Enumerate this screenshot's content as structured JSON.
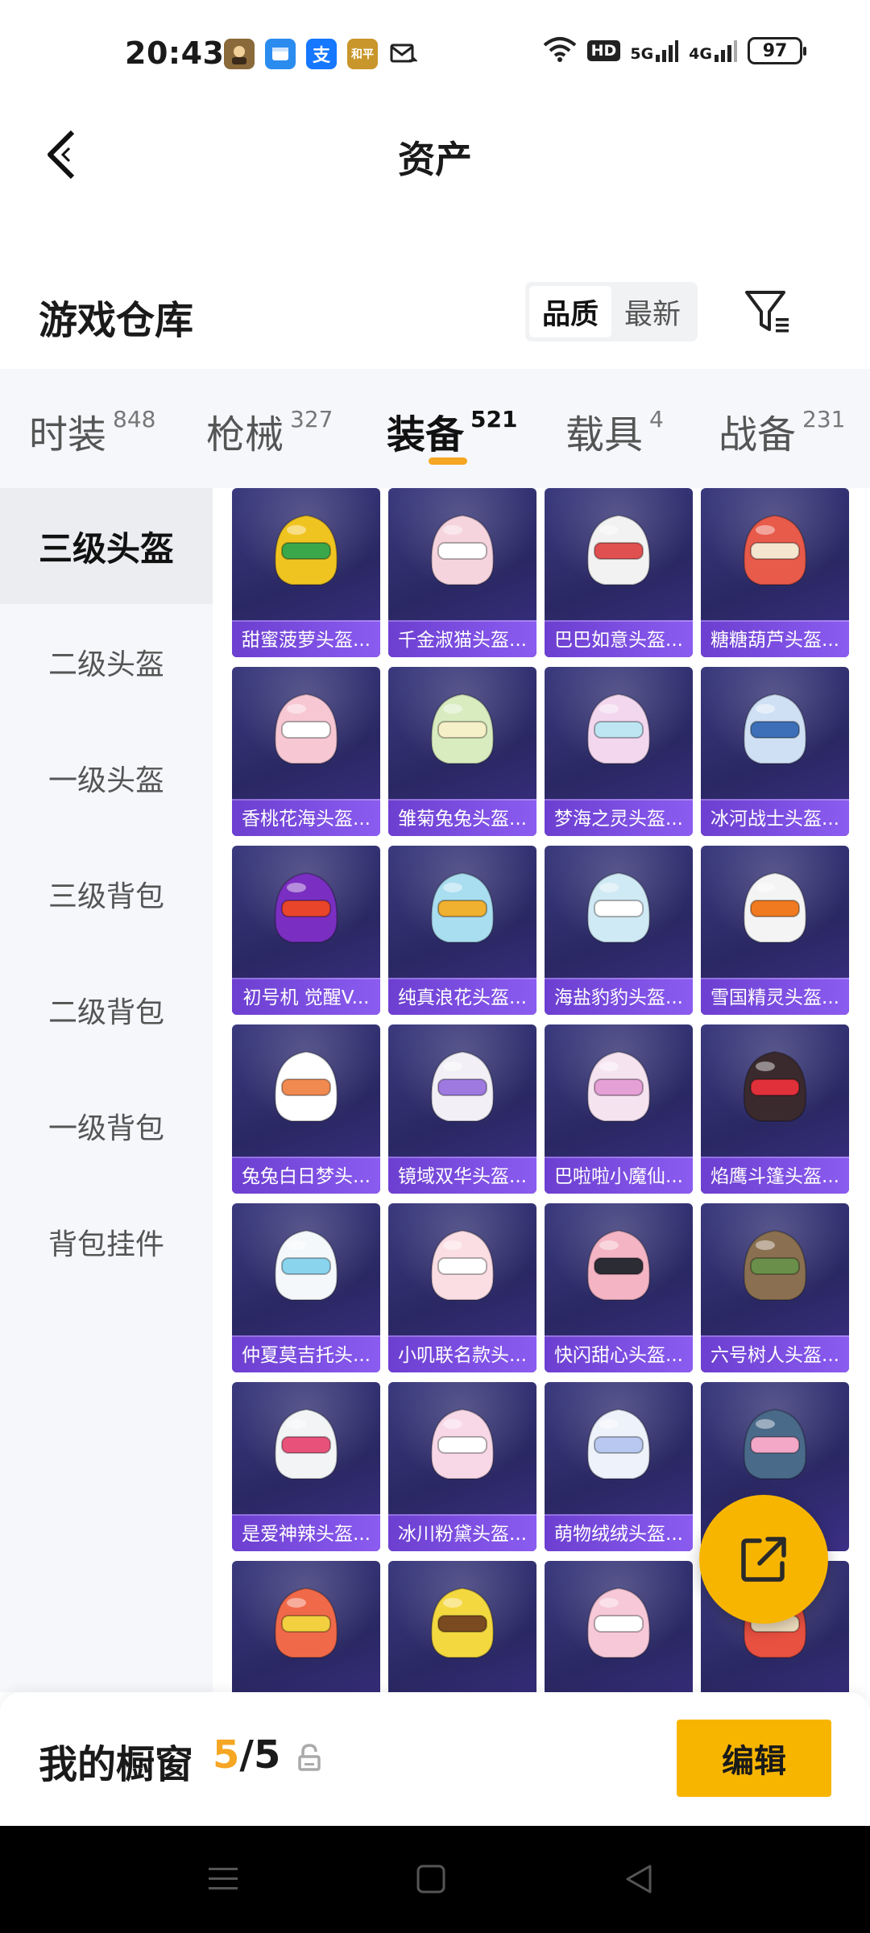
{
  "status_bar": {
    "time": "20:43",
    "battery": "97",
    "network_1": "5G",
    "network_2": "4G",
    "hd_badge": "HD",
    "notif_alipay": "支",
    "notif_pubg": "和平"
  },
  "header": {
    "title": "资产"
  },
  "warehouse": {
    "title": "游戏仓库",
    "sort_options": [
      "品质",
      "最新"
    ],
    "active_sort": "品质"
  },
  "tabs": [
    {
      "label": "时装",
      "count": "848"
    },
    {
      "label": "枪械",
      "count": "327"
    },
    {
      "label": "装备",
      "count": "521"
    },
    {
      "label": "载具",
      "count": "4"
    },
    {
      "label": "战备",
      "count": "231"
    }
  ],
  "active_tab": "装备",
  "sidebar": {
    "items": [
      {
        "label": "三级头盔"
      },
      {
        "label": "二级头盔"
      },
      {
        "label": "一级头盔"
      },
      {
        "label": "三级背包"
      },
      {
        "label": "二级背包"
      },
      {
        "label": "一级背包"
      },
      {
        "label": "背包挂件"
      }
    ],
    "active": "三级头盔"
  },
  "items": [
    {
      "name": "甜蜜菠萝头盔...",
      "color": "#f0c420",
      "accent": "#3aa84a"
    },
    {
      "name": "千金淑猫头盔...",
      "color": "#f6d4de",
      "accent": "#ffffff"
    },
    {
      "name": "巴巴如意头盔...",
      "color": "#f2f2f2",
      "accent": "#e05050"
    },
    {
      "name": "糖糖葫芦头盔...",
      "color": "#e85a4a",
      "accent": "#f5e6d0"
    },
    {
      "name": "香桃花海头盔...",
      "color": "#f7c8d4",
      "accent": "#ffffff"
    },
    {
      "name": "雏菊兔兔头盔...",
      "color": "#d8ecc0",
      "accent": "#f6f0c8"
    },
    {
      "name": "梦海之灵头盔...",
      "color": "#f3d7ef",
      "accent": "#bde6f2"
    },
    {
      "name": "冰河战士头盔...",
      "color": "#cfe0f5",
      "accent": "#3c6fb8"
    },
    {
      "name": "初号机 觉醒V...",
      "color": "#7a2fc2",
      "accent": "#e8452b"
    },
    {
      "name": "纯真浪花头盔...",
      "color": "#a9ddf0",
      "accent": "#f0b030"
    },
    {
      "name": "海盐豹豹头盔...",
      "color": "#cfeaf5",
      "accent": "#ffffff"
    },
    {
      "name": "雪国精灵头盔...",
      "color": "#f4f4f4",
      "accent": "#f07a20"
    },
    {
      "name": "兔兔白日梦头...",
      "color": "#ffffff",
      "accent": "#f08a50"
    },
    {
      "name": "镜域双华头盔...",
      "color": "#f2f0f6",
      "accent": "#9e7ae0"
    },
    {
      "name": "巴啦啦小魔仙...",
      "color": "#f6e3f0",
      "accent": "#e5a0d6"
    },
    {
      "name": "焰鹰斗篷头盔...",
      "color": "#3a2a2e",
      "accent": "#e0303a"
    },
    {
      "name": "仲夏莫吉托头...",
      "color": "#f4f8fa",
      "accent": "#8ad4ee"
    },
    {
      "name": "小叽联名款头...",
      "color": "#fbdde4",
      "accent": "#ffffff"
    },
    {
      "name": "快闪甜心头盔...",
      "color": "#f4b4c4",
      "accent": "#2c2c34"
    },
    {
      "name": "六号树人头盔...",
      "color": "#8a7050",
      "accent": "#6a8f4a"
    },
    {
      "name": "是爱神辣头盔...",
      "color": "#f2f4f6",
      "accent": "#e8527a"
    },
    {
      "name": "冰川粉黛头盔...",
      "color": "#f8d8e6",
      "accent": "#ffffff"
    },
    {
      "name": "萌物绒绒头盔...",
      "color": "#eef2fa",
      "accent": "#b8c8f0"
    },
    {
      "name": "",
      "color": "#4a6a8a",
      "accent": "#f3a8c8"
    },
    {
      "name": "",
      "color": "#f06a4a",
      "accent": "#f2d040"
    },
    {
      "name": "",
      "color": "#f4d840",
      "accent": "#7a4a20"
    },
    {
      "name": "",
      "color": "#f6c8d8",
      "accent": "#ffffff"
    },
    {
      "name": "",
      "color": "#e85040",
      "accent": "#f2e0c0"
    }
  ],
  "showcase": {
    "title": "我的橱窗",
    "current": "5",
    "separator": "/",
    "total": "5",
    "edit_label": "编辑"
  },
  "colors": {
    "accent": "#f5a623",
    "button_yellow": "#f7b500",
    "card_bg": "#2e2c6c",
    "label_purple": "#7a4ee0"
  }
}
